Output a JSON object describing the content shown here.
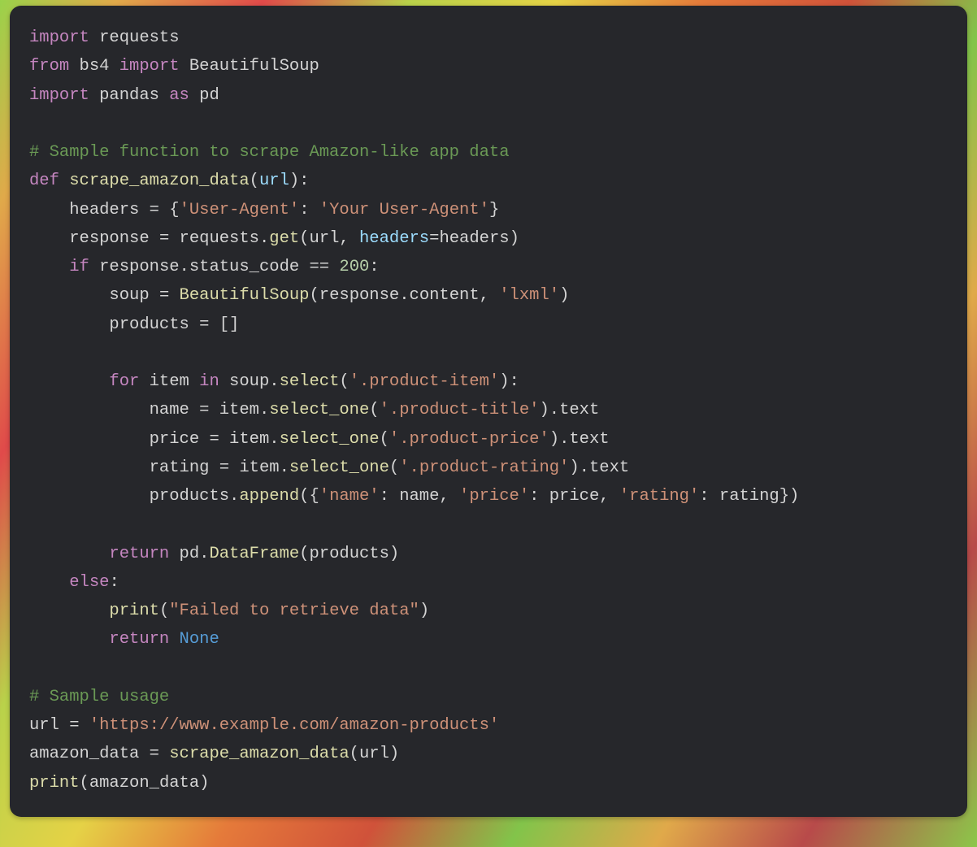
{
  "code": {
    "l01": {
      "kw1": "import",
      "mod1": "requests"
    },
    "l02": {
      "kw1": "from",
      "mod1": "bs4",
      "kw2": "import",
      "mod2": "BeautifulSoup"
    },
    "l03": {
      "kw1": "import",
      "mod1": "pandas",
      "kw2": "as",
      "mod2": "pd"
    },
    "l04": "",
    "l05": {
      "comment": "# Sample function to scrape Amazon-like app data"
    },
    "l06": {
      "kw1": "def",
      "fname": "scrape_amazon_data",
      "lp": "(",
      "param": "url",
      "rp": "):"
    },
    "l07": {
      "indent": "    ",
      "lhs": "headers ",
      "eq": "= ",
      "lbrace": "{",
      "key": "'User-Agent'",
      "colon": ": ",
      "val": "'Your User-Agent'",
      "rbrace": "}"
    },
    "l08": {
      "indent": "    ",
      "lhs": "response ",
      "eq": "= ",
      "obj": "requests.",
      "fn": "get",
      "lp": "(",
      "arg1": "url",
      "comma": ", ",
      "kwarg": "headers",
      "eq2": "=",
      "arg2": "headers",
      "rp": ")"
    },
    "l09": {
      "indent": "    ",
      "kw": "if",
      "cond": " response.status_code ",
      "op": "== ",
      "num": "200",
      "colon": ":"
    },
    "l10": {
      "indent": "        ",
      "lhs": "soup ",
      "eq": "= ",
      "fn": "BeautifulSoup",
      "lp": "(",
      "arg1": "response.content",
      "comma": ", ",
      "str": "'lxml'",
      "rp": ")"
    },
    "l11": {
      "indent": "        ",
      "lhs": "products ",
      "eq": "= ",
      "val": "[]"
    },
    "l12": "",
    "l13": {
      "indent": "        ",
      "kw1": "for",
      "var": " item ",
      "kw2": "in",
      "obj": " soup.",
      "fn": "select",
      "lp": "(",
      "str": "'.product-item'",
      "rp": "):"
    },
    "l14": {
      "indent": "            ",
      "lhs": "name ",
      "eq": "= ",
      "obj": "item.",
      "fn": "select_one",
      "lp": "(",
      "str": "'.product-title'",
      "rp": ")",
      "tail": ".text"
    },
    "l15": {
      "indent": "            ",
      "lhs": "price ",
      "eq": "= ",
      "obj": "item.",
      "fn": "select_one",
      "lp": "(",
      "str": "'.product-price'",
      "rp": ")",
      "tail": ".text"
    },
    "l16": {
      "indent": "            ",
      "lhs": "rating ",
      "eq": "= ",
      "obj": "item.",
      "fn": "select_one",
      "lp": "(",
      "str": "'.product-rating'",
      "rp": ")",
      "tail": ".text"
    },
    "l17": {
      "indent": "            ",
      "obj": "products.",
      "fn": "append",
      "lp": "({",
      "k1": "'name'",
      "c1": ": ",
      "v1": "name",
      "comma1": ", ",
      "k2": "'price'",
      "c2": ": ",
      "v2": "price",
      "comma2": ", ",
      "k3": "'rating'",
      "c3": ": ",
      "v3": "rating",
      "rp": "})"
    },
    "l18": "",
    "l19": {
      "indent": "        ",
      "kw": "return",
      "sp": " ",
      "obj": "pd.",
      "fn": "DataFrame",
      "lp": "(",
      "arg": "products",
      "rp": ")"
    },
    "l20": {
      "indent": "    ",
      "kw": "else",
      "colon": ":"
    },
    "l21": {
      "indent": "        ",
      "fn": "print",
      "lp": "(",
      "str": "\"Failed to retrieve data\"",
      "rp": ")"
    },
    "l22": {
      "indent": "        ",
      "kw": "return",
      "sp": " ",
      "const": "None"
    },
    "l23": "",
    "l24": {
      "comment": "# Sample usage"
    },
    "l25": {
      "lhs": "url ",
      "eq": "= ",
      "str": "'https://www.example.com/amazon-products'"
    },
    "l26": {
      "lhs": "amazon_data ",
      "eq": "= ",
      "fn": "scrape_amazon_data",
      "lp": "(",
      "arg": "url",
      "rp": ")"
    },
    "l27": {
      "fn": "print",
      "lp": "(",
      "arg": "amazon_data",
      "rp": ")"
    }
  }
}
